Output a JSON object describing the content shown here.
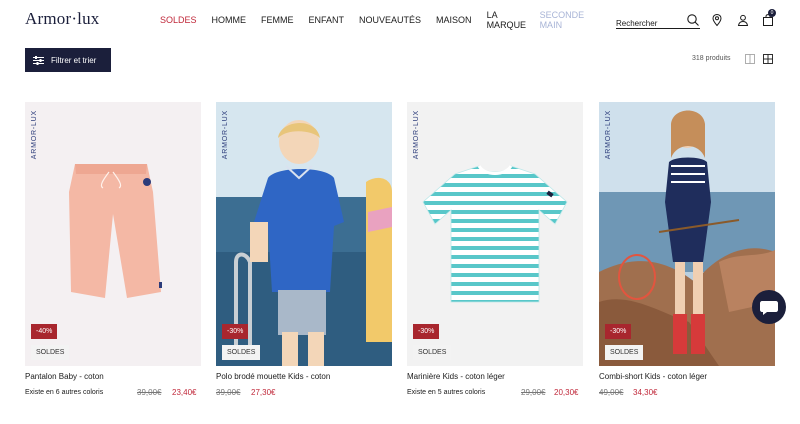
{
  "header": {
    "logo": "Armor·lux",
    "nav": [
      {
        "label": "SOLDES",
        "style": "sale"
      },
      {
        "label": "HOMME",
        "style": ""
      },
      {
        "label": "FEMME",
        "style": ""
      },
      {
        "label": "ENFANT",
        "style": ""
      },
      {
        "label": "NOUVEAUTÉS",
        "style": ""
      },
      {
        "label": "MAISON",
        "style": ""
      },
      {
        "label": "LA MARQUE",
        "style": "two"
      },
      {
        "label": "SECONDE MAIN",
        "style": "muted two"
      }
    ],
    "search_placeholder": "Rechercher",
    "cart_count": "0"
  },
  "toolbar": {
    "filter_label": "Filtrer et trier",
    "count": "318 produits"
  },
  "products": [
    {
      "name": "Pantalon Baby - coton",
      "colors": "Existe en 6  autres coloris",
      "old_price": "39,00€",
      "new_price": "23,40€",
      "discount": "-40%",
      "badge": "SOLDES",
      "brand": "ARMOR-LUX"
    },
    {
      "name": "Polo brodé mouette Kids - coton",
      "colors": "",
      "old_price": "39,00€",
      "new_price": "27,30€",
      "discount": "-30%",
      "badge": "SOLDES",
      "brand": "ARMOR-LUX"
    },
    {
      "name": "Marinière Kids - coton léger",
      "colors": "Existe en 5  autres coloris",
      "old_price": "29,00€",
      "new_price": "20,30€",
      "discount": "-30%",
      "badge": "SOLDES",
      "brand": "ARMOR-LUX"
    },
    {
      "name": "Combi-short Kids - coton léger",
      "colors": "",
      "old_price": "49,00€",
      "new_price": "34,30€",
      "discount": "-30%",
      "badge": "SOLDES",
      "brand": "ARMOR-LUX"
    }
  ],
  "colors": {
    "navy": "#1b1f3b",
    "sale_red": "#c0283a",
    "discount_red": "#a8262e"
  }
}
